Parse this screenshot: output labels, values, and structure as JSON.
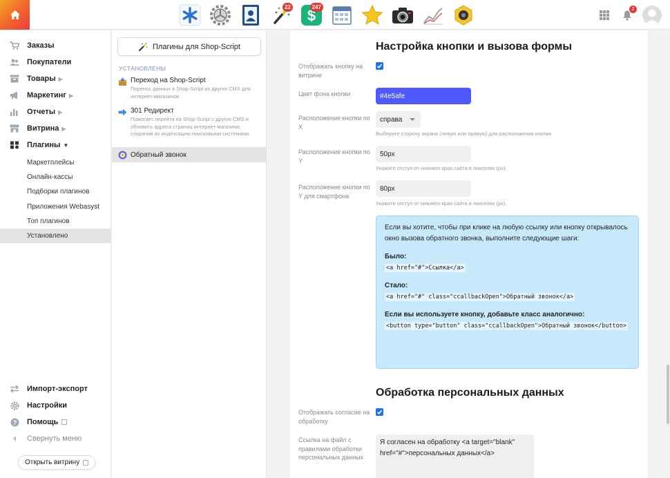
{
  "apps": [
    {
      "name": "asterisk-app-icon",
      "badge": ""
    },
    {
      "name": "gear-app-icon",
      "badge": ""
    },
    {
      "name": "contacts-app-icon",
      "badge": ""
    },
    {
      "name": "magic-wand-app-icon",
      "badge": "22"
    },
    {
      "name": "shop-dollar-app-icon",
      "badge": "247"
    },
    {
      "name": "calendar-app-icon",
      "badge": ""
    },
    {
      "name": "star-app-icon",
      "badge": ""
    },
    {
      "name": "camera-app-icon",
      "badge": ""
    },
    {
      "name": "chart-app-icon",
      "badge": ""
    },
    {
      "name": "webcam-app-icon",
      "badge": ""
    }
  ],
  "topbar": {
    "notifications_count": "2"
  },
  "sidebar": {
    "items": [
      {
        "label": "Заказы",
        "icon": "cart-icon"
      },
      {
        "label": "Покупатели",
        "icon": "users-icon"
      },
      {
        "label": "Товары",
        "icon": "box-icon"
      },
      {
        "label": "Маркетинг",
        "icon": "megaphone-icon"
      },
      {
        "label": "Отчеты",
        "icon": "bar-chart-icon"
      },
      {
        "label": "Витрина",
        "icon": "storefront-icon"
      },
      {
        "label": "Плагины",
        "icon": "puzzle-icon"
      }
    ],
    "subitems": [
      "Маркетплейсы",
      "Онлайн-кассы",
      "Подборки плагинов",
      "Приложения Webasyst",
      "Топ плагинов",
      "Установлено"
    ],
    "bottom": {
      "import_export": "Импорт-экспорт",
      "settings": "Настройки",
      "help": "Помощь",
      "collapse": "Свернуть меню",
      "open_store": "Открыть витрину"
    }
  },
  "plugins": {
    "button_label": "Плагины для Shop-Script",
    "installed_heading": "УСТАНОВЛЕНЫ",
    "list": [
      {
        "title": "Переход на Shop-Script",
        "desc": "Перенос данных в Shop-Script из других CMS для интернет-магазинов"
      },
      {
        "title": "301 Редирект",
        "desc": "Помогает перейти на Shop-Script с других CMS и обновить адреса страниц интернет-магазина, сохранив их индексацию поисковыми системами."
      },
      {
        "title": "Обратный звонок",
        "desc": ""
      }
    ]
  },
  "form": {
    "section1_title": "Настройка кнопки и вызова формы",
    "show_button_label": "Отображать кнопку на витрине",
    "bg_color_label": "Цвет фона кнопки",
    "bg_color_value": "#4e5afe",
    "pos_x_label": "Расположение кнопки по X",
    "pos_x_value": "справа",
    "pos_x_hint": "Выберите сторону экрана (левую или правую) для расположения кнопки.",
    "pos_y_label": "Расположение кнопки по Y",
    "pos_y_value": "50px",
    "pos_y_hint": "Укажите отступ от нижнего края сайта в пикселях (px).",
    "pos_y_mobile_label": "Расположение кнопки по Y для смартфона",
    "pos_y_mobile_value": "80px",
    "pos_y_mobile_hint": "Укажите отступ от нижнего края сайта в пикселях (px).",
    "info": {
      "intro": "Если вы хотите, чтобы при клике на любую ссылку или кнопку открывалось окно вызова обратного звонка, выполните следующие шаги:",
      "before_label": "Было:",
      "before_code": "<a href=\"#\">Ссылка</a>",
      "after_label": "Стало:",
      "after_code": "<a href=\"#\" class=\"ccallbackOpen\">Обратный звонок</a>",
      "button_label": "Если вы используете кнопку, добавьте класс аналогично:",
      "button_code": "<button type=\"button\" class=\"ccallbackOpen\">Обратный звонок</button>"
    },
    "section2_title": "Обработка персональных данных",
    "show_consent_label": "Отображать согласие на обработку",
    "consent_link_label": "Ссылка на файл с правилами обработки персональных данных",
    "consent_text": "Я согласен на обработку <a target=\"blank\" href=\"#\">персональных данных</a>"
  }
}
